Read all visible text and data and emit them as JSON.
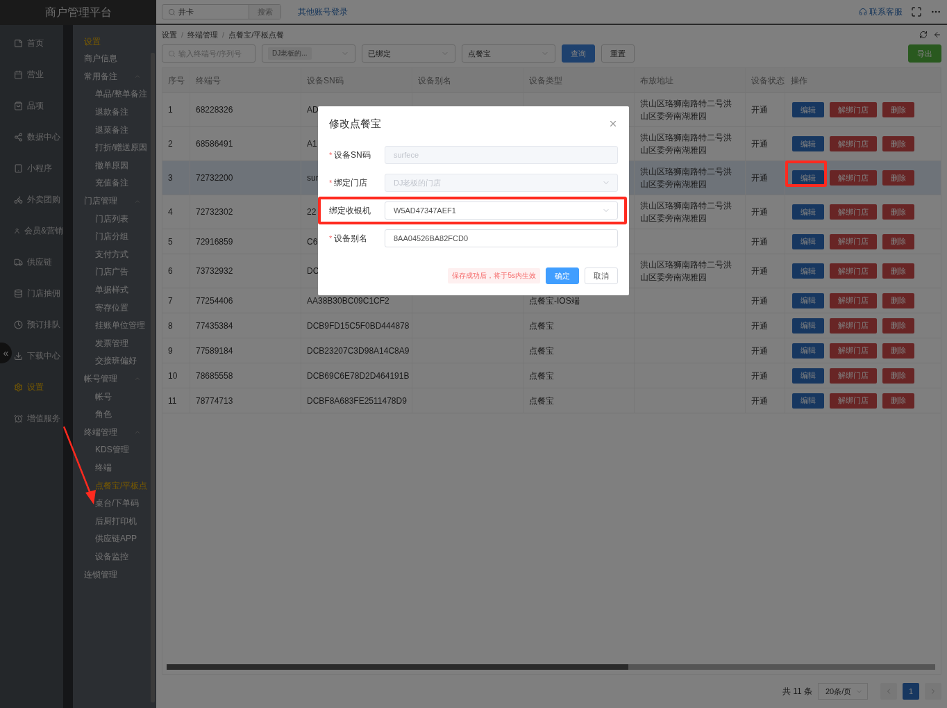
{
  "app_title": "商户管理平台",
  "topbar": {
    "search": {
      "value": "井卡",
      "button": "搜索"
    },
    "link": "其他账号登录",
    "support": "联系客服"
  },
  "nav": {
    "items": [
      {
        "label": "首页",
        "selected": false
      },
      {
        "label": "营业",
        "selected": false
      },
      {
        "label": "品项",
        "selected": false
      },
      {
        "label": "数据中心",
        "selected": false
      },
      {
        "label": "小程序",
        "selected": false
      },
      {
        "label": "外卖团购",
        "selected": false
      },
      {
        "label": "会员&营销",
        "selected": false
      },
      {
        "label": "供应链",
        "selected": false
      },
      {
        "label": "门店抽佣",
        "selected": false
      },
      {
        "label": "预订排队",
        "selected": false
      },
      {
        "label": "下载中心",
        "selected": false
      },
      {
        "label": "设置",
        "selected": true
      },
      {
        "label": "增值服务",
        "selected": false
      }
    ],
    "collapse": "«"
  },
  "submenu": {
    "title": "设置",
    "items": [
      {
        "label": "商户信息",
        "selected": false
      },
      {
        "label": "常用备注",
        "expanded": true,
        "children": [
          {
            "label": "单品/整单备注",
            "selected": false
          },
          {
            "label": "退款备注",
            "selected": false
          },
          {
            "label": "退菜备注",
            "selected": false
          },
          {
            "label": "打折/赠送原因",
            "selected": false
          },
          {
            "label": "撤单原因",
            "selected": false
          },
          {
            "label": "充值备注",
            "selected": false
          }
        ]
      },
      {
        "label": "门店管理",
        "expanded": true,
        "children": [
          {
            "label": "门店列表",
            "selected": false
          },
          {
            "label": "门店分组",
            "selected": false
          },
          {
            "label": "支付方式",
            "selected": false
          },
          {
            "label": "门店广告",
            "selected": false
          },
          {
            "label": "单据样式",
            "selected": false
          },
          {
            "label": "寄存位置",
            "selected": false
          },
          {
            "label": "挂账单位管理",
            "selected": false
          },
          {
            "label": "发票管理",
            "selected": false
          },
          {
            "label": "交接班偏好",
            "selected": false
          }
        ]
      },
      {
        "label": "帐号管理",
        "expanded": true,
        "children": [
          {
            "label": "帐号",
            "selected": false
          },
          {
            "label": "角色",
            "selected": false
          }
        ]
      },
      {
        "label": "终端管理",
        "expanded": true,
        "children": [
          {
            "label": "KDS管理",
            "selected": false
          },
          {
            "label": "终端",
            "selected": false
          },
          {
            "label": "点餐宝/平板点",
            "selected": true
          },
          {
            "label": "桌台/下单码",
            "selected": false
          },
          {
            "label": "后厨打印机",
            "selected": false
          },
          {
            "label": "供应链APP",
            "selected": false
          },
          {
            "label": "设备监控",
            "selected": false
          }
        ]
      },
      {
        "label": "连锁管理",
        "selected": false
      }
    ]
  },
  "breadcrumb": {
    "items": [
      "设置",
      "终端管理",
      "点餐宝/平板点餐"
    ],
    "separator": "/"
  },
  "filters": [
    {
      "kind": "search",
      "placeholder": "输入终端号/序列号"
    },
    {
      "kind": "tag-select",
      "tag": "DJ老板的..."
    },
    {
      "kind": "select",
      "value": "已绑定"
    },
    {
      "kind": "select",
      "value": "点餐宝"
    }
  ],
  "filter_buttons": [
    {
      "label": "查询",
      "kind": "primary"
    },
    {
      "label": "重置",
      "kind": "default"
    }
  ],
  "export_button": "导出",
  "table": {
    "columns": [
      "序号",
      "终端号",
      "设备SN码",
      "设备别名",
      "设备类型",
      "布放地址",
      "设备状态",
      "操作"
    ],
    "rows": [
      {
        "index": "1",
        "terminal": "68228326",
        "sn": "AD",
        "alias": "",
        "type": "",
        "address": "洪山区珞狮南路特二号洪山区委旁南湖雅园",
        "status": "开通",
        "selected": false,
        "actions": [
          {
            "label": "编辑",
            "kind": "primary",
            "highlighted": false
          },
          {
            "label": "解绑门店",
            "kind": "danger",
            "highlighted": false
          },
          {
            "label": "删除",
            "kind": "danger",
            "highlighted": false
          }
        ]
      },
      {
        "index": "2",
        "terminal": "68586491",
        "sn": "A1",
        "alias": "",
        "type": "",
        "address": "洪山区珞狮南路特二号洪山区委旁南湖雅园",
        "status": "开通",
        "selected": false,
        "actions": [
          {
            "label": "编辑",
            "kind": "primary",
            "highlighted": false
          },
          {
            "label": "解绑门店",
            "kind": "danger",
            "highlighted": false
          },
          {
            "label": "删除",
            "kind": "danger",
            "highlighted": false
          }
        ]
      },
      {
        "index": "3",
        "terminal": "72732200",
        "sn": "sur",
        "alias": "",
        "type": "",
        "address": "洪山区珞狮南路特二号洪山区委旁南湖雅园",
        "status": "开通",
        "selected": true,
        "actions": [
          {
            "label": "编辑",
            "kind": "primary",
            "highlighted": true
          },
          {
            "label": "解绑门店",
            "kind": "danger",
            "highlighted": false
          },
          {
            "label": "删除",
            "kind": "danger",
            "highlighted": false
          }
        ]
      },
      {
        "index": "4",
        "terminal": "72732302",
        "sn": "22",
        "alias": "",
        "type": "",
        "address": "洪山区珞狮南路特二号洪山区委旁南湖雅园",
        "status": "开通",
        "selected": false,
        "actions": [
          {
            "label": "编辑",
            "kind": "primary",
            "highlighted": false
          },
          {
            "label": "解绑门店",
            "kind": "danger",
            "highlighted": false
          },
          {
            "label": "删除",
            "kind": "danger",
            "highlighted": false
          }
        ]
      },
      {
        "index": "5",
        "terminal": "72916859",
        "sn": "C6",
        "alias": "",
        "type": "",
        "address": "",
        "status": "开通",
        "selected": false,
        "actions": [
          {
            "label": "编辑",
            "kind": "primary",
            "highlighted": false
          },
          {
            "label": "解绑门店",
            "kind": "danger",
            "highlighted": false
          },
          {
            "label": "删除",
            "kind": "danger",
            "highlighted": false
          }
        ]
      },
      {
        "index": "6",
        "terminal": "73732932",
        "sn": "DC",
        "alias": "",
        "type": "",
        "address": "洪山区珞狮南路特二号洪山区委旁南湖雅园",
        "status": "开通",
        "selected": false,
        "actions": [
          {
            "label": "编辑",
            "kind": "primary",
            "highlighted": false
          },
          {
            "label": "解绑门店",
            "kind": "danger",
            "highlighted": false
          },
          {
            "label": "删除",
            "kind": "danger",
            "highlighted": false
          }
        ]
      },
      {
        "index": "7",
        "terminal": "77254406",
        "sn": "AA38B30BC09C1CF2",
        "alias": "",
        "type": "点餐宝-IOS端",
        "address": "",
        "status": "开通",
        "selected": false,
        "actions": [
          {
            "label": "编辑",
            "kind": "primary",
            "highlighted": false
          },
          {
            "label": "解绑门店",
            "kind": "danger",
            "highlighted": false
          },
          {
            "label": "删除",
            "kind": "danger",
            "highlighted": false
          }
        ]
      },
      {
        "index": "8",
        "terminal": "77435384",
        "sn": "DCB9FD15C5F0BD444878",
        "alias": "",
        "type": "点餐宝",
        "address": "",
        "status": "开通",
        "selected": false,
        "actions": [
          {
            "label": "编辑",
            "kind": "primary",
            "highlighted": false
          },
          {
            "label": "解绑门店",
            "kind": "danger",
            "highlighted": false
          },
          {
            "label": "删除",
            "kind": "danger",
            "highlighted": false
          }
        ]
      },
      {
        "index": "9",
        "terminal": "77589184",
        "sn": "DCB23207C3D98A14C8A9",
        "alias": "",
        "type": "点餐宝",
        "address": "",
        "status": "开通",
        "selected": false,
        "actions": [
          {
            "label": "编辑",
            "kind": "primary",
            "highlighted": false
          },
          {
            "label": "解绑门店",
            "kind": "danger",
            "highlighted": false
          },
          {
            "label": "删除",
            "kind": "danger",
            "highlighted": false
          }
        ]
      },
      {
        "index": "10",
        "terminal": "78685558",
        "sn": "DCB69C6E78D2D464191B",
        "alias": "",
        "type": "点餐宝",
        "address": "",
        "status": "开通",
        "selected": false,
        "actions": [
          {
            "label": "编辑",
            "kind": "primary",
            "highlighted": false
          },
          {
            "label": "解绑门店",
            "kind": "danger",
            "highlighted": false
          },
          {
            "label": "删除",
            "kind": "danger",
            "highlighted": false
          }
        ]
      },
      {
        "index": "11",
        "terminal": "78774713",
        "sn": "DCBF8A683FE2511478D9",
        "alias": "",
        "type": "点餐宝",
        "address": "",
        "status": "开通",
        "selected": false,
        "actions": [
          {
            "label": "编辑",
            "kind": "primary",
            "highlighted": false
          },
          {
            "label": "解绑门店",
            "kind": "danger",
            "highlighted": false
          },
          {
            "label": "删除",
            "kind": "danger",
            "highlighted": false
          }
        ]
      }
    ]
  },
  "pagination": {
    "total": "共 11 条",
    "page_size": "20条/页",
    "pages": [
      {
        "label": "1",
        "selected": true
      }
    ]
  },
  "modal": {
    "title": "修改点餐宝",
    "required_mark": "*",
    "fields": [
      {
        "label": "设备SN码",
        "kind": "input",
        "required": true,
        "disabled": true,
        "highlighted": false,
        "value": "surfece"
      },
      {
        "label": "绑定门店",
        "kind": "select",
        "required": true,
        "disabled": true,
        "highlighted": false,
        "value": "DJ老板的门店"
      },
      {
        "label": "绑定收银机",
        "kind": "select",
        "required": false,
        "disabled": false,
        "highlighted": true,
        "value": "W5AD47347AEF1"
      },
      {
        "label": "设备别名",
        "kind": "input",
        "required": true,
        "disabled": false,
        "highlighted": false,
        "value": "8AA04526BA82FCD0"
      }
    ],
    "tip": "保存成功后，将于5s内生效",
    "buttons": [
      {
        "label": "确定",
        "kind": "primary"
      },
      {
        "label": "取消",
        "kind": "default"
      }
    ]
  }
}
